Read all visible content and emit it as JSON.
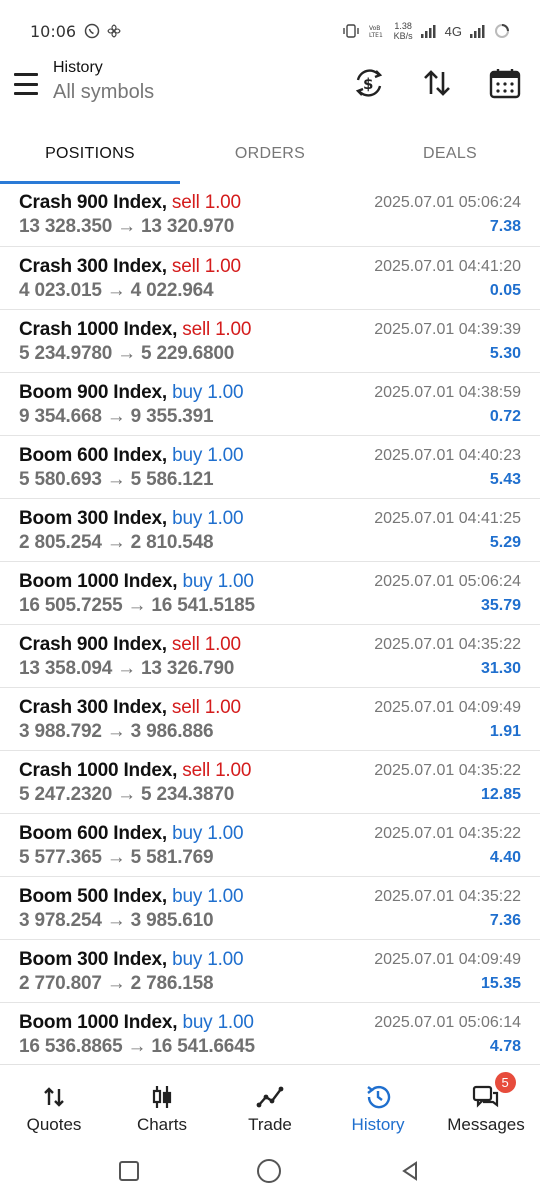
{
  "status_bar": {
    "time": "10:06",
    "speed_value": "1.38",
    "speed_unit": "KB/s",
    "network": "4G"
  },
  "header": {
    "title": "History",
    "subtitle": "All symbols"
  },
  "tabs": [
    {
      "label": "POSITIONS"
    },
    {
      "label": "ORDERS"
    },
    {
      "label": "DEALS"
    }
  ],
  "positions": [
    {
      "symbol": "Crash 900 Index,",
      "side": "sell 1.00",
      "prices": "13 328.350 → 13 320.970",
      "date": "2025.07.01 05:06:24",
      "profit": "7.38"
    },
    {
      "symbol": "Crash 300 Index,",
      "side": "sell 1.00",
      "prices": "4 023.015 → 4 022.964",
      "date": "2025.07.01 04:41:20",
      "profit": "0.05"
    },
    {
      "symbol": "Crash 1000 Index,",
      "side": "sell 1.00",
      "prices": "5 234.9780 → 5 229.6800",
      "date": "2025.07.01 04:39:39",
      "profit": "5.30"
    },
    {
      "symbol": "Boom 900 Index,",
      "side": "buy 1.00",
      "prices": "9 354.668 → 9 355.391",
      "date": "2025.07.01 04:38:59",
      "profit": "0.72"
    },
    {
      "symbol": "Boom 600 Index,",
      "side": "buy 1.00",
      "prices": "5 580.693 → 5 586.121",
      "date": "2025.07.01 04:40:23",
      "profit": "5.43"
    },
    {
      "symbol": "Boom 300 Index,",
      "side": "buy 1.00",
      "prices": "2 805.254 → 2 810.548",
      "date": "2025.07.01 04:41:25",
      "profit": "5.29"
    },
    {
      "symbol": "Boom 1000 Index,",
      "side": "buy 1.00",
      "prices": "16 505.7255 → 16 541.5185",
      "date": "2025.07.01 05:06:24",
      "profit": "35.79"
    },
    {
      "symbol": "Crash 900 Index,",
      "side": "sell 1.00",
      "prices": "13 358.094 → 13 326.790",
      "date": "2025.07.01 04:35:22",
      "profit": "31.30"
    },
    {
      "symbol": "Crash 300 Index,",
      "side": "sell 1.00",
      "prices": "3 988.792 → 3 986.886",
      "date": "2025.07.01 04:09:49",
      "profit": "1.91"
    },
    {
      "symbol": "Crash 1000 Index,",
      "side": "sell 1.00",
      "prices": "5 247.2320 → 5 234.3870",
      "date": "2025.07.01 04:35:22",
      "profit": "12.85"
    },
    {
      "symbol": "Boom 600 Index,",
      "side": "buy 1.00",
      "prices": "5 577.365 → 5 581.769",
      "date": "2025.07.01 04:35:22",
      "profit": "4.40"
    },
    {
      "symbol": "Boom 500 Index,",
      "side": "buy 1.00",
      "prices": "3 978.254 → 3 985.610",
      "date": "2025.07.01 04:35:22",
      "profit": "7.36"
    },
    {
      "symbol": "Boom 300 Index,",
      "side": "buy 1.00",
      "prices": "2 770.807 → 2 786.158",
      "date": "2025.07.01 04:09:49",
      "profit": "15.35"
    },
    {
      "symbol": "Boom 1000 Index,",
      "side": "buy 1.00",
      "prices": "16 536.8865 → 16 541.6645",
      "date": "2025.07.01 05:06:14",
      "profit": "4.78"
    }
  ],
  "bottom_nav": [
    {
      "label": "Quotes",
      "icon": "quotes-arrows-icon"
    },
    {
      "label": "Charts",
      "icon": "candlestick-icon"
    },
    {
      "label": "Trade",
      "icon": "trade-line-icon"
    },
    {
      "label": "History",
      "icon": "history-clock-icon"
    },
    {
      "label": "Messages",
      "icon": "chat-bubbles-icon",
      "badge": "5"
    }
  ],
  "colors": {
    "accent": "#1f6fce",
    "sell": "#d41c1c",
    "buy": "#1f6fce",
    "badge": "#e74c3c"
  }
}
